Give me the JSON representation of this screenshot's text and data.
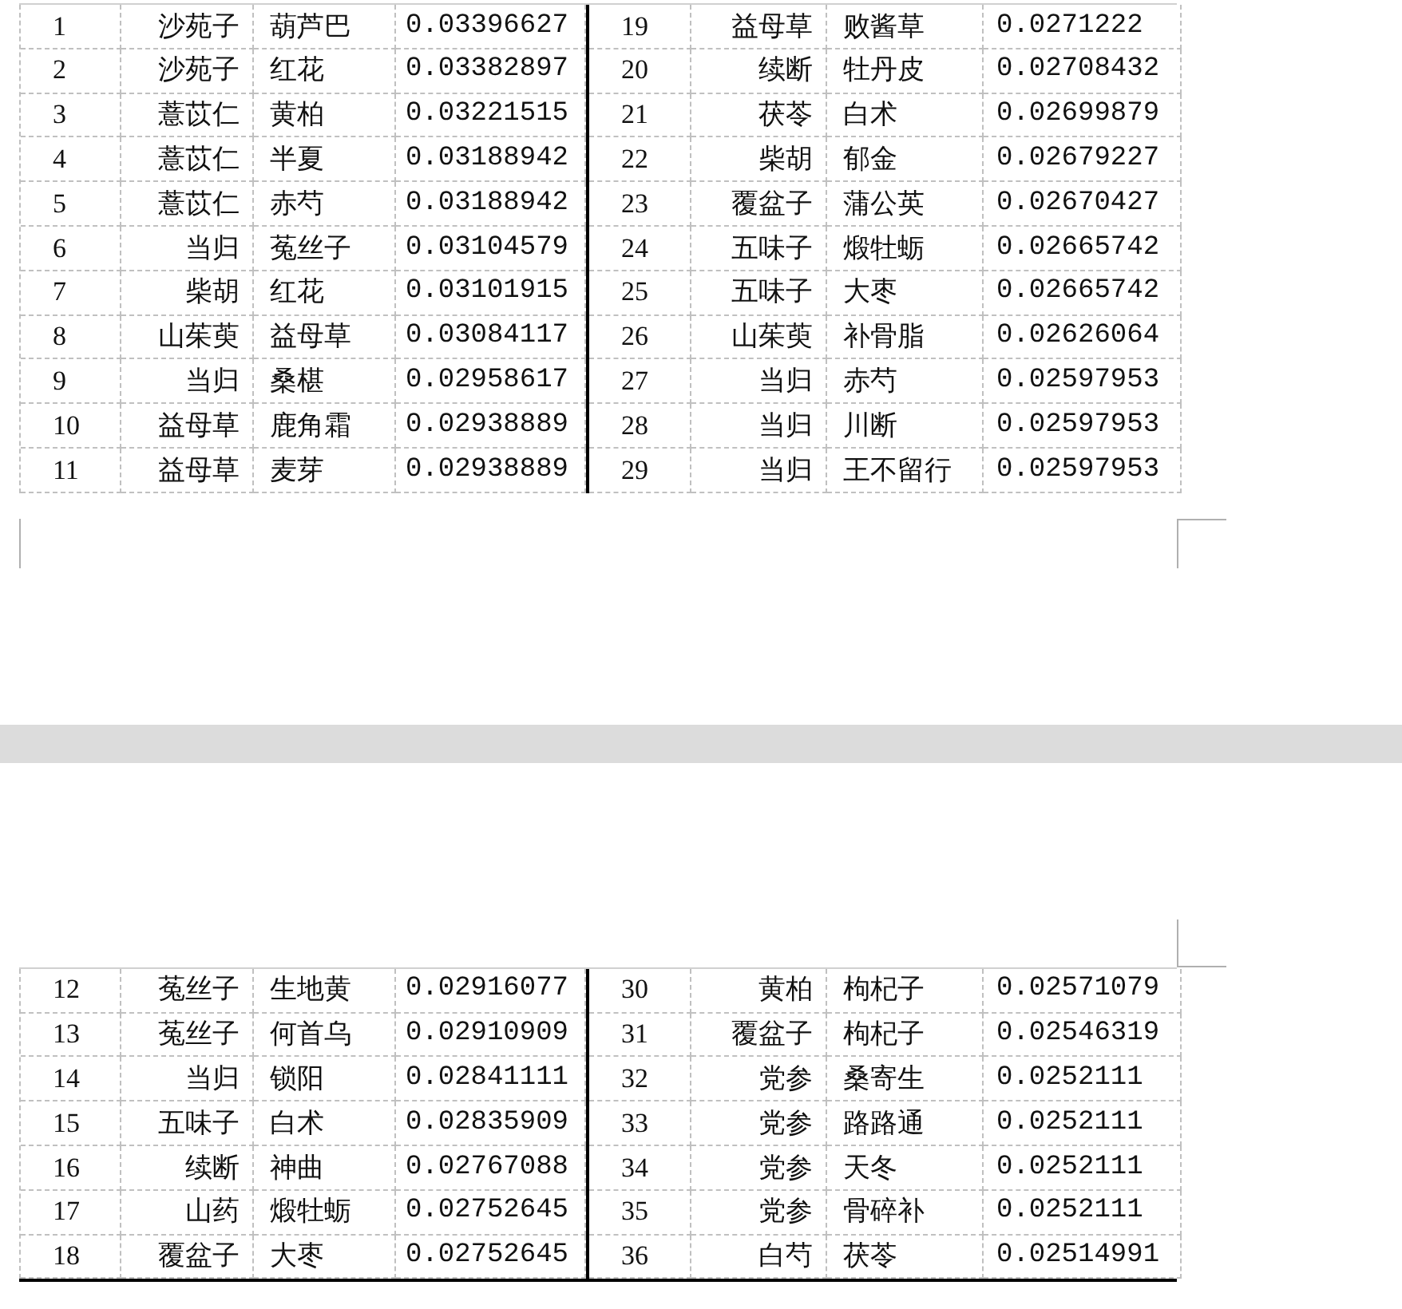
{
  "pages": [
    {
      "left_rows": [
        {
          "index": "1",
          "herb_a": "沙苑子",
          "herb_b": "葫芦巴",
          "value": "0.03396627"
        },
        {
          "index": "2",
          "herb_a": "沙苑子",
          "herb_b": "红花",
          "value": "0.03382897"
        },
        {
          "index": "3",
          "herb_a": "薏苡仁",
          "herb_b": "黄柏",
          "value": "0.03221515"
        },
        {
          "index": "4",
          "herb_a": "薏苡仁",
          "herb_b": "半夏",
          "value": "0.03188942"
        },
        {
          "index": "5",
          "herb_a": "薏苡仁",
          "herb_b": "赤芍",
          "value": "0.03188942"
        },
        {
          "index": "6",
          "herb_a": "当归",
          "herb_b": "菟丝子",
          "value": "0.03104579"
        },
        {
          "index": "7",
          "herb_a": "柴胡",
          "herb_b": "红花",
          "value": "0.03101915"
        },
        {
          "index": "8",
          "herb_a": "山茱萸",
          "herb_b": "益母草",
          "value": "0.03084117"
        },
        {
          "index": "9",
          "herb_a": "当归",
          "herb_b": "桑椹",
          "value": "0.02958617"
        },
        {
          "index": "10",
          "herb_a": "益母草",
          "herb_b": "鹿角霜",
          "value": "0.02938889"
        },
        {
          "index": "11",
          "herb_a": "益母草",
          "herb_b": "麦芽",
          "value": "0.02938889"
        }
      ],
      "right_rows": [
        {
          "index": "19",
          "herb_a": "益母草",
          "herb_b": "败酱草",
          "value": "0.0271222"
        },
        {
          "index": "20",
          "herb_a": "续断",
          "herb_b": "牡丹皮",
          "value": "0.02708432"
        },
        {
          "index": "21",
          "herb_a": "茯苓",
          "herb_b": "白术",
          "value": "0.02699879"
        },
        {
          "index": "22",
          "herb_a": "柴胡",
          "herb_b": "郁金",
          "value": "0.02679227"
        },
        {
          "index": "23",
          "herb_a": "覆盆子",
          "herb_b": "蒲公英",
          "value": "0.02670427"
        },
        {
          "index": "24",
          "herb_a": "五味子",
          "herb_b": "煅牡蛎",
          "value": "0.02665742"
        },
        {
          "index": "25",
          "herb_a": "五味子",
          "herb_b": "大枣",
          "value": "0.02665742"
        },
        {
          "index": "26",
          "herb_a": "山茱萸",
          "herb_b": "补骨脂",
          "value": "0.02626064"
        },
        {
          "index": "27",
          "herb_a": "当归",
          "herb_b": "赤芍",
          "value": "0.02597953"
        },
        {
          "index": "28",
          "herb_a": "当归",
          "herb_b": "川断",
          "value": "0.02597953"
        },
        {
          "index": "29",
          "herb_a": "当归",
          "herb_b": "王不留行",
          "value": "0.02597953"
        }
      ]
    },
    {
      "left_rows": [
        {
          "index": "12",
          "herb_a": "菟丝子",
          "herb_b": "生地黄",
          "value": "0.02916077"
        },
        {
          "index": "13",
          "herb_a": "菟丝子",
          "herb_b": "何首乌",
          "value": "0.02910909"
        },
        {
          "index": "14",
          "herb_a": "当归",
          "herb_b": "锁阳",
          "value": "0.02841111"
        },
        {
          "index": "15",
          "herb_a": "五味子",
          "herb_b": "白术",
          "value": "0.02835909"
        },
        {
          "index": "16",
          "herb_a": "续断",
          "herb_b": "神曲",
          "value": "0.02767088"
        },
        {
          "index": "17",
          "herb_a": "山药",
          "herb_b": "煅牡蛎",
          "value": "0.02752645"
        },
        {
          "index": "18",
          "herb_a": "覆盆子",
          "herb_b": "大枣",
          "value": "0.02752645"
        }
      ],
      "right_rows": [
        {
          "index": "30",
          "herb_a": "黄柏",
          "herb_b": "枸杞子",
          "value": "0.02571079"
        },
        {
          "index": "31",
          "herb_a": "覆盆子",
          "herb_b": "枸杞子",
          "value": "0.02546319"
        },
        {
          "index": "32",
          "herb_a": "党参",
          "herb_b": "桑寄生",
          "value": "0.0252111"
        },
        {
          "index": "33",
          "herb_a": "党参",
          "herb_b": "路路通",
          "value": "0.0252111"
        },
        {
          "index": "34",
          "herb_a": "党参",
          "herb_b": "天冬",
          "value": "0.0252111"
        },
        {
          "index": "35",
          "herb_a": "党参",
          "herb_b": "骨碎补",
          "value": "0.0252111"
        },
        {
          "index": "36",
          "herb_a": "白芍",
          "herb_b": "茯苓",
          "value": "0.02514991"
        }
      ]
    }
  ]
}
